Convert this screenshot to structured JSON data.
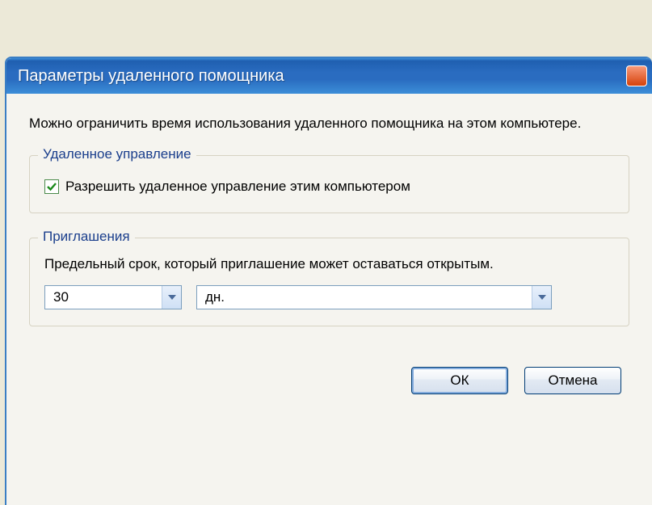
{
  "window": {
    "title": "Параметры удаленного помощника"
  },
  "intro": "Можно ограничить время использования удаленного помощника на этом компьютере.",
  "remoteControl": {
    "legend": "Удаленное управление",
    "checkboxLabel": "Разрешить удаленное управление этим компьютером",
    "checked": true
  },
  "invitations": {
    "legend": "Приглашения",
    "label": "Предельный срок, который приглашение может оставаться открытым.",
    "amount": "30",
    "unit": "дн."
  },
  "buttons": {
    "ok": "ОК",
    "cancel": "Отмена"
  }
}
